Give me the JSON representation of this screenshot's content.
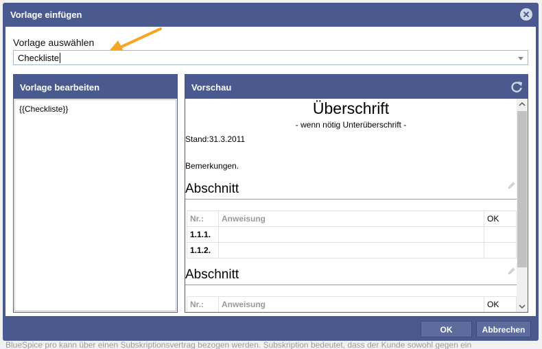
{
  "dialog": {
    "title": "Vorlage einfügen",
    "choose_label": "Vorlage auswählen",
    "selected_template": "Checkliste"
  },
  "left_panel": {
    "title": "Vorlage bearbeiten",
    "content": "{{Checkliste}}"
  },
  "right_panel": {
    "title": "Vorschau",
    "heading": "Überschrift",
    "subheading": "- wenn nötig Unterüberschrift -",
    "stand": "Stand:31.3.2011",
    "remarks": "Bemerkungen.",
    "section1": "Abschnitt",
    "section2": "Abschnitt",
    "table_headers": [
      "Nr.:",
      "Anweisung",
      "OK"
    ],
    "rows": [
      "1.1.1.",
      "1.1.2."
    ]
  },
  "buttons": {
    "ok": "OK",
    "cancel": "Abbrechen"
  },
  "background": {
    "footer_text": "BlueSpice pro kann über einen Subskriptionsvertrag bezogen werden. Subskription bedeutet, dass der Kunde sowohl gegen ein"
  },
  "colors": {
    "dialog_header": "#4a5a8f",
    "button": "#5c6c9d",
    "annotation_arrow": "#f5a623"
  },
  "icons": {
    "close": "close-icon",
    "refresh": "refresh-icon",
    "dropdown": "chevron-down-icon",
    "edit": "pencil-icon"
  }
}
